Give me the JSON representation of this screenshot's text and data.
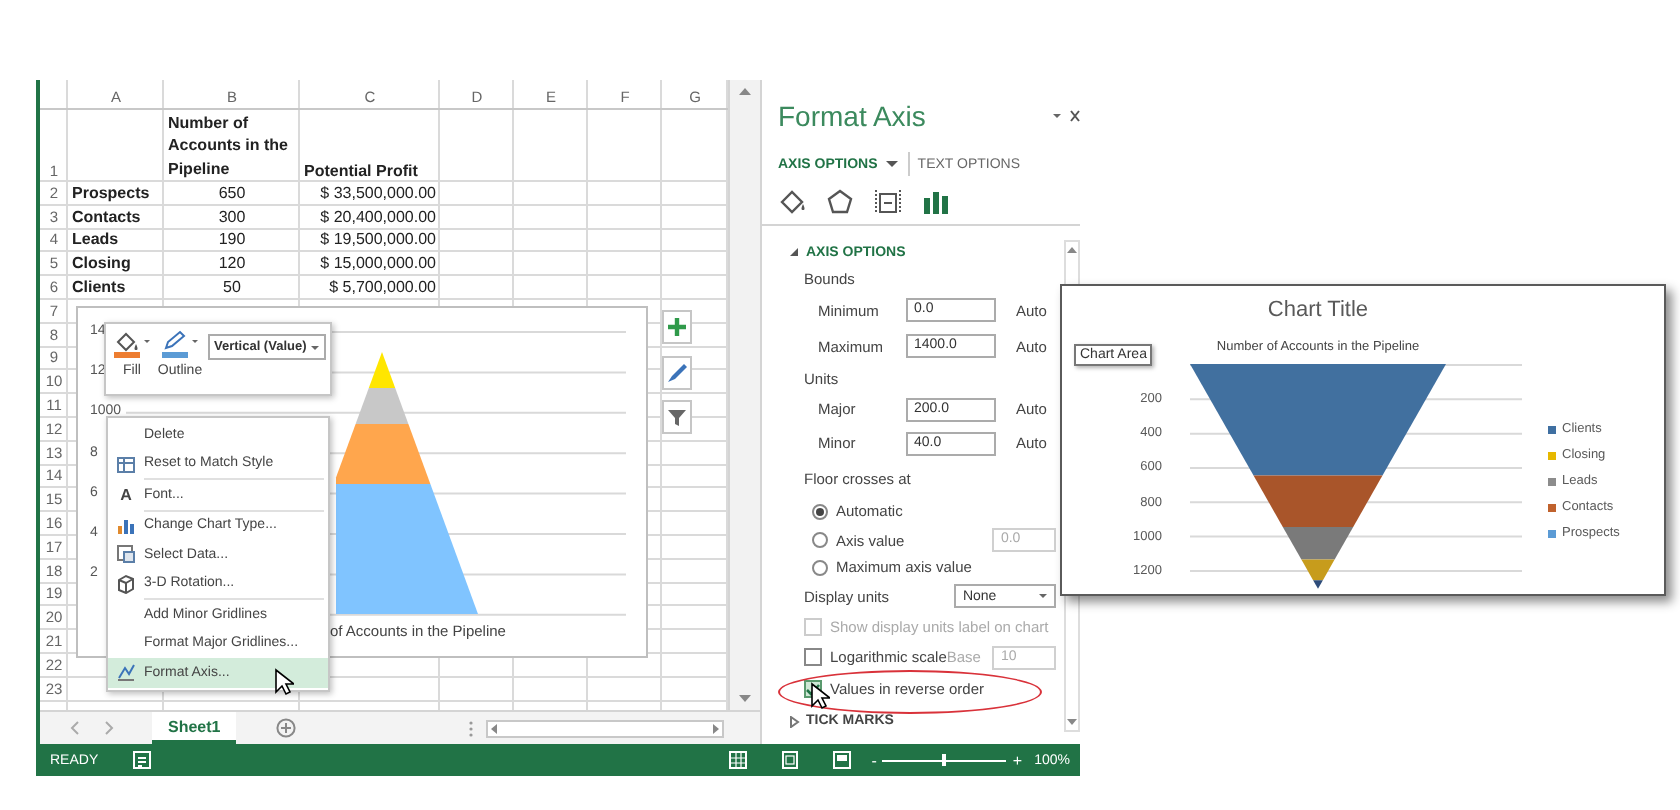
{
  "sheet": {
    "columns": [
      "A",
      "B",
      "C",
      "D",
      "E",
      "F",
      "G"
    ],
    "header_row": {
      "number": "1",
      "accounts": "Number of Accounts in the Pipeline",
      "profit": "Potential Profit"
    },
    "rows": [
      {
        "number": "2",
        "label": "Prospects",
        "accounts": "650",
        "profit": "$ 33,500,000.00"
      },
      {
        "number": "3",
        "label": "Contacts",
        "accounts": "300",
        "profit": "$ 20,400,000.00"
      },
      {
        "number": "4",
        "label": "Leads",
        "accounts": "190",
        "profit": "$ 19,500,000.00"
      },
      {
        "number": "5",
        "label": "Closing",
        "accounts": "120",
        "profit": "$ 15,000,000.00"
      },
      {
        "number": "6",
        "label": "Clients",
        "accounts": "50",
        "profit": "$ 5,700,000.00"
      }
    ],
    "empty_rows": [
      "7",
      "8",
      "9",
      "10",
      "11",
      "12",
      "13",
      "14",
      "15",
      "16",
      "17",
      "18",
      "19",
      "20",
      "21",
      "22",
      "23"
    ],
    "tabs": [
      {
        "label": "Sheet1",
        "selected": true
      }
    ]
  },
  "chart": {
    "axis_labels": [
      "14",
      "12",
      "1000",
      "8",
      "6",
      "4",
      "2"
    ],
    "caption": "of Accounts in the Pipeline"
  },
  "mini_toolbar": {
    "buttons": [
      {
        "kind": "fill",
        "label": "Fill"
      },
      {
        "kind": "outline",
        "label": "Outline"
      }
    ],
    "element_picker": "Vertical (Value)"
  },
  "context_menu": {
    "groups": [
      [
        {
          "label": "Delete",
          "kind": "plain",
          "selected": false
        },
        {
          "label": "Reset to Match Style",
          "kind": "reset",
          "selected": false
        }
      ],
      [
        {
          "label": "Font...",
          "kind": "glyph",
          "glyph": "A",
          "selected": false
        }
      ],
      [
        {
          "label": "Change Chart Type...",
          "kind": "chart",
          "selected": false
        },
        {
          "label": "Select Data...",
          "kind": "data",
          "selected": false
        },
        {
          "label": "3-D Rotation...",
          "kind": "rotation",
          "selected": false
        }
      ],
      [
        {
          "label": "Add Minor Gridlines",
          "kind": "plain",
          "selected": false
        },
        {
          "label": "Format Major Gridlines...",
          "kind": "plain",
          "selected": false
        },
        {
          "label": "Format Axis...",
          "kind": "axis",
          "selected": true
        }
      ]
    ]
  },
  "format_pane": {
    "title": "Format Axis",
    "tabs": [
      {
        "label": "AXIS OPTIONS",
        "selected": true
      },
      {
        "label": "TEXT OPTIONS",
        "selected": false
      }
    ],
    "icon_tabs": [
      {
        "kind": "fill",
        "selected": false
      },
      {
        "kind": "effects",
        "selected": false
      },
      {
        "kind": "size",
        "selected": false
      },
      {
        "kind": "axis",
        "selected": true
      }
    ],
    "section": {
      "title": "AXIS OPTIONS",
      "expanded": true
    },
    "bounds_label": "Bounds",
    "bounds": [
      {
        "label": "Minimum",
        "value": "0.0",
        "reset": "Auto"
      },
      {
        "label": "Maximum",
        "value": "1400.0",
        "reset": "Auto"
      }
    ],
    "units_label": "Units",
    "units": [
      {
        "label": "Major",
        "value": "200.0",
        "reset": "Auto"
      },
      {
        "label": "Minor",
        "value": "40.0",
        "reset": "Auto"
      }
    ],
    "floor_label": "Floor crosses at",
    "floor_options": [
      {
        "label": "Automatic",
        "selected": true
      },
      {
        "label": "Axis value",
        "selected": false,
        "value": "0.0"
      },
      {
        "label": "Maximum axis value",
        "selected": false
      }
    ],
    "display_units": {
      "label": "Display units",
      "value": "None"
    },
    "show_units_label": {
      "label": "Show display units label on chart",
      "checked": false,
      "disabled": true
    },
    "log_scale": {
      "label": "Logarithmic scale",
      "checked": false,
      "base_label": "Base",
      "base": "10"
    },
    "reverse_order": {
      "label": "Values in reverse order",
      "checked": true,
      "highlighted": true
    },
    "next_section": {
      "title": "TICK MARKS",
      "expanded": false
    }
  },
  "inset_chart": {
    "title": "Chart Title",
    "tooltip": "Chart Area",
    "subtitle": "Number of Accounts in the Pipeline",
    "y_ticks": [
      "200",
      "400",
      "600",
      "800",
      "1000",
      "1200"
    ],
    "legend": [
      {
        "label": "Clients",
        "color": "#3f6fa1"
      },
      {
        "label": "Closing",
        "color": "#e6b800"
      },
      {
        "label": "Leads",
        "color": "#8c8c8c"
      },
      {
        "label": "Contacts",
        "color": "#c0622d"
      },
      {
        "label": "Prospects",
        "color": "#5b9bd5"
      }
    ]
  },
  "status_bar": {
    "status": "READY",
    "zoom": {
      "minus": "-",
      "plus": "+",
      "level": 0.5,
      "reading": "100%"
    }
  }
}
